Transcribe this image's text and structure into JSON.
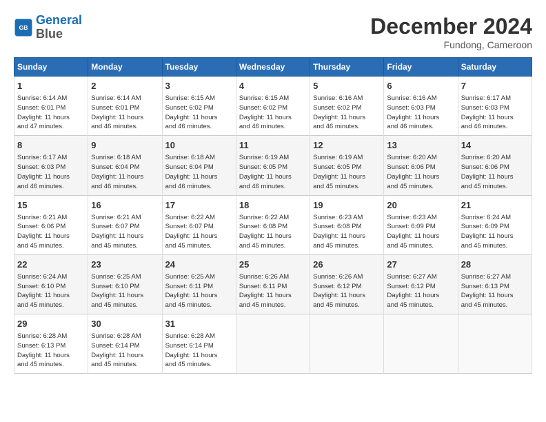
{
  "header": {
    "logo_line1": "General",
    "logo_line2": "Blue",
    "month_year": "December 2024",
    "location": "Fundong, Cameroon"
  },
  "days_of_week": [
    "Sunday",
    "Monday",
    "Tuesday",
    "Wednesday",
    "Thursday",
    "Friday",
    "Saturday"
  ],
  "weeks": [
    [
      {
        "day": "1",
        "info": "Sunrise: 6:14 AM\nSunset: 6:01 PM\nDaylight: 11 hours\nand 47 minutes."
      },
      {
        "day": "2",
        "info": "Sunrise: 6:14 AM\nSunset: 6:01 PM\nDaylight: 11 hours\nand 46 minutes."
      },
      {
        "day": "3",
        "info": "Sunrise: 6:15 AM\nSunset: 6:02 PM\nDaylight: 11 hours\nand 46 minutes."
      },
      {
        "day": "4",
        "info": "Sunrise: 6:15 AM\nSunset: 6:02 PM\nDaylight: 11 hours\nand 46 minutes."
      },
      {
        "day": "5",
        "info": "Sunrise: 6:16 AM\nSunset: 6:02 PM\nDaylight: 11 hours\nand 46 minutes."
      },
      {
        "day": "6",
        "info": "Sunrise: 6:16 AM\nSunset: 6:03 PM\nDaylight: 11 hours\nand 46 minutes."
      },
      {
        "day": "7",
        "info": "Sunrise: 6:17 AM\nSunset: 6:03 PM\nDaylight: 11 hours\nand 46 minutes."
      }
    ],
    [
      {
        "day": "8",
        "info": "Sunrise: 6:17 AM\nSunset: 6:03 PM\nDaylight: 11 hours\nand 46 minutes."
      },
      {
        "day": "9",
        "info": "Sunrise: 6:18 AM\nSunset: 6:04 PM\nDaylight: 11 hours\nand 46 minutes."
      },
      {
        "day": "10",
        "info": "Sunrise: 6:18 AM\nSunset: 6:04 PM\nDaylight: 11 hours\nand 46 minutes."
      },
      {
        "day": "11",
        "info": "Sunrise: 6:19 AM\nSunset: 6:05 PM\nDaylight: 11 hours\nand 46 minutes."
      },
      {
        "day": "12",
        "info": "Sunrise: 6:19 AM\nSunset: 6:05 PM\nDaylight: 11 hours\nand 45 minutes."
      },
      {
        "day": "13",
        "info": "Sunrise: 6:20 AM\nSunset: 6:06 PM\nDaylight: 11 hours\nand 45 minutes."
      },
      {
        "day": "14",
        "info": "Sunrise: 6:20 AM\nSunset: 6:06 PM\nDaylight: 11 hours\nand 45 minutes."
      }
    ],
    [
      {
        "day": "15",
        "info": "Sunrise: 6:21 AM\nSunset: 6:06 PM\nDaylight: 11 hours\nand 45 minutes."
      },
      {
        "day": "16",
        "info": "Sunrise: 6:21 AM\nSunset: 6:07 PM\nDaylight: 11 hours\nand 45 minutes."
      },
      {
        "day": "17",
        "info": "Sunrise: 6:22 AM\nSunset: 6:07 PM\nDaylight: 11 hours\nand 45 minutes."
      },
      {
        "day": "18",
        "info": "Sunrise: 6:22 AM\nSunset: 6:08 PM\nDaylight: 11 hours\nand 45 minutes."
      },
      {
        "day": "19",
        "info": "Sunrise: 6:23 AM\nSunset: 6:08 PM\nDaylight: 11 hours\nand 45 minutes."
      },
      {
        "day": "20",
        "info": "Sunrise: 6:23 AM\nSunset: 6:09 PM\nDaylight: 11 hours\nand 45 minutes."
      },
      {
        "day": "21",
        "info": "Sunrise: 6:24 AM\nSunset: 6:09 PM\nDaylight: 11 hours\nand 45 minutes."
      }
    ],
    [
      {
        "day": "22",
        "info": "Sunrise: 6:24 AM\nSunset: 6:10 PM\nDaylight: 11 hours\nand 45 minutes."
      },
      {
        "day": "23",
        "info": "Sunrise: 6:25 AM\nSunset: 6:10 PM\nDaylight: 11 hours\nand 45 minutes."
      },
      {
        "day": "24",
        "info": "Sunrise: 6:25 AM\nSunset: 6:11 PM\nDaylight: 11 hours\nand 45 minutes."
      },
      {
        "day": "25",
        "info": "Sunrise: 6:26 AM\nSunset: 6:11 PM\nDaylight: 11 hours\nand 45 minutes."
      },
      {
        "day": "26",
        "info": "Sunrise: 6:26 AM\nSunset: 6:12 PM\nDaylight: 11 hours\nand 45 minutes."
      },
      {
        "day": "27",
        "info": "Sunrise: 6:27 AM\nSunset: 6:12 PM\nDaylight: 11 hours\nand 45 minutes."
      },
      {
        "day": "28",
        "info": "Sunrise: 6:27 AM\nSunset: 6:13 PM\nDaylight: 11 hours\nand 45 minutes."
      }
    ],
    [
      {
        "day": "29",
        "info": "Sunrise: 6:28 AM\nSunset: 6:13 PM\nDaylight: 11 hours\nand 45 minutes."
      },
      {
        "day": "30",
        "info": "Sunrise: 6:28 AM\nSunset: 6:14 PM\nDaylight: 11 hours\nand 45 minutes."
      },
      {
        "day": "31",
        "info": "Sunrise: 6:28 AM\nSunset: 6:14 PM\nDaylight: 11 hours\nand 45 minutes."
      },
      {
        "day": "",
        "info": ""
      },
      {
        "day": "",
        "info": ""
      },
      {
        "day": "",
        "info": ""
      },
      {
        "day": "",
        "info": ""
      }
    ]
  ]
}
